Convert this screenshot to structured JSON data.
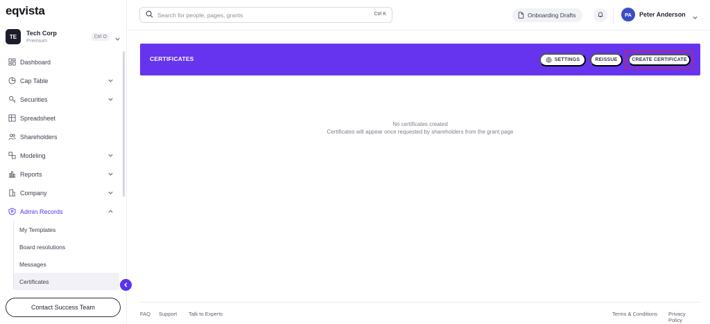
{
  "app": {
    "logo": "eqvista"
  },
  "org": {
    "initials": "TE",
    "name": "Tech Corp",
    "plan": "Premium",
    "shortcut": "Ctrl O"
  },
  "sidebar": {
    "items": [
      {
        "label": "Dashboard",
        "icon": "dashboard-icon"
      },
      {
        "label": "Cap Table",
        "icon": "pie-chart-icon",
        "expandable": true
      },
      {
        "label": "Securities",
        "icon": "securities-icon",
        "expandable": true
      },
      {
        "label": "Spreadsheet",
        "icon": "spreadsheet-icon"
      },
      {
        "label": "Shareholders",
        "icon": "users-icon"
      },
      {
        "label": "Modeling",
        "icon": "modeling-icon",
        "expandable": true
      },
      {
        "label": "Reports",
        "icon": "reports-icon",
        "expandable": true
      },
      {
        "label": "Company",
        "icon": "company-icon",
        "expandable": true
      },
      {
        "label": "Admin Records",
        "icon": "shield-icon",
        "expandable": true,
        "expanded": true
      }
    ],
    "admin_sub": [
      "My Templates",
      "Board resolutions",
      "Messages",
      "Certificates"
    ],
    "contact_label": "Contact Success Team"
  },
  "header": {
    "search_placeholder": "Search for people, pages, grants",
    "search_shortcut": "Ctrl K",
    "drafts_label": "Onboarding Drafts",
    "user_initials": "PA",
    "user_name": "Peter Anderson"
  },
  "main": {
    "title": "CERTIFICATES",
    "settings_label": "SETTINGS",
    "reissue_label": "REISSUE",
    "create_label": "CREATE CERTIFICATE",
    "empty_title": "No certificates created",
    "empty_subtitle": "Certificates will appear once requested by shareholders from the grant page"
  },
  "footer": {
    "links": [
      "FAQ",
      "Support",
      "Talk to Experts"
    ],
    "right_links": [
      "Terms & Conditions",
      "Privacy Policy"
    ]
  },
  "colors": {
    "accent": "#6634ee",
    "highlight_border": "#e0242b"
  }
}
